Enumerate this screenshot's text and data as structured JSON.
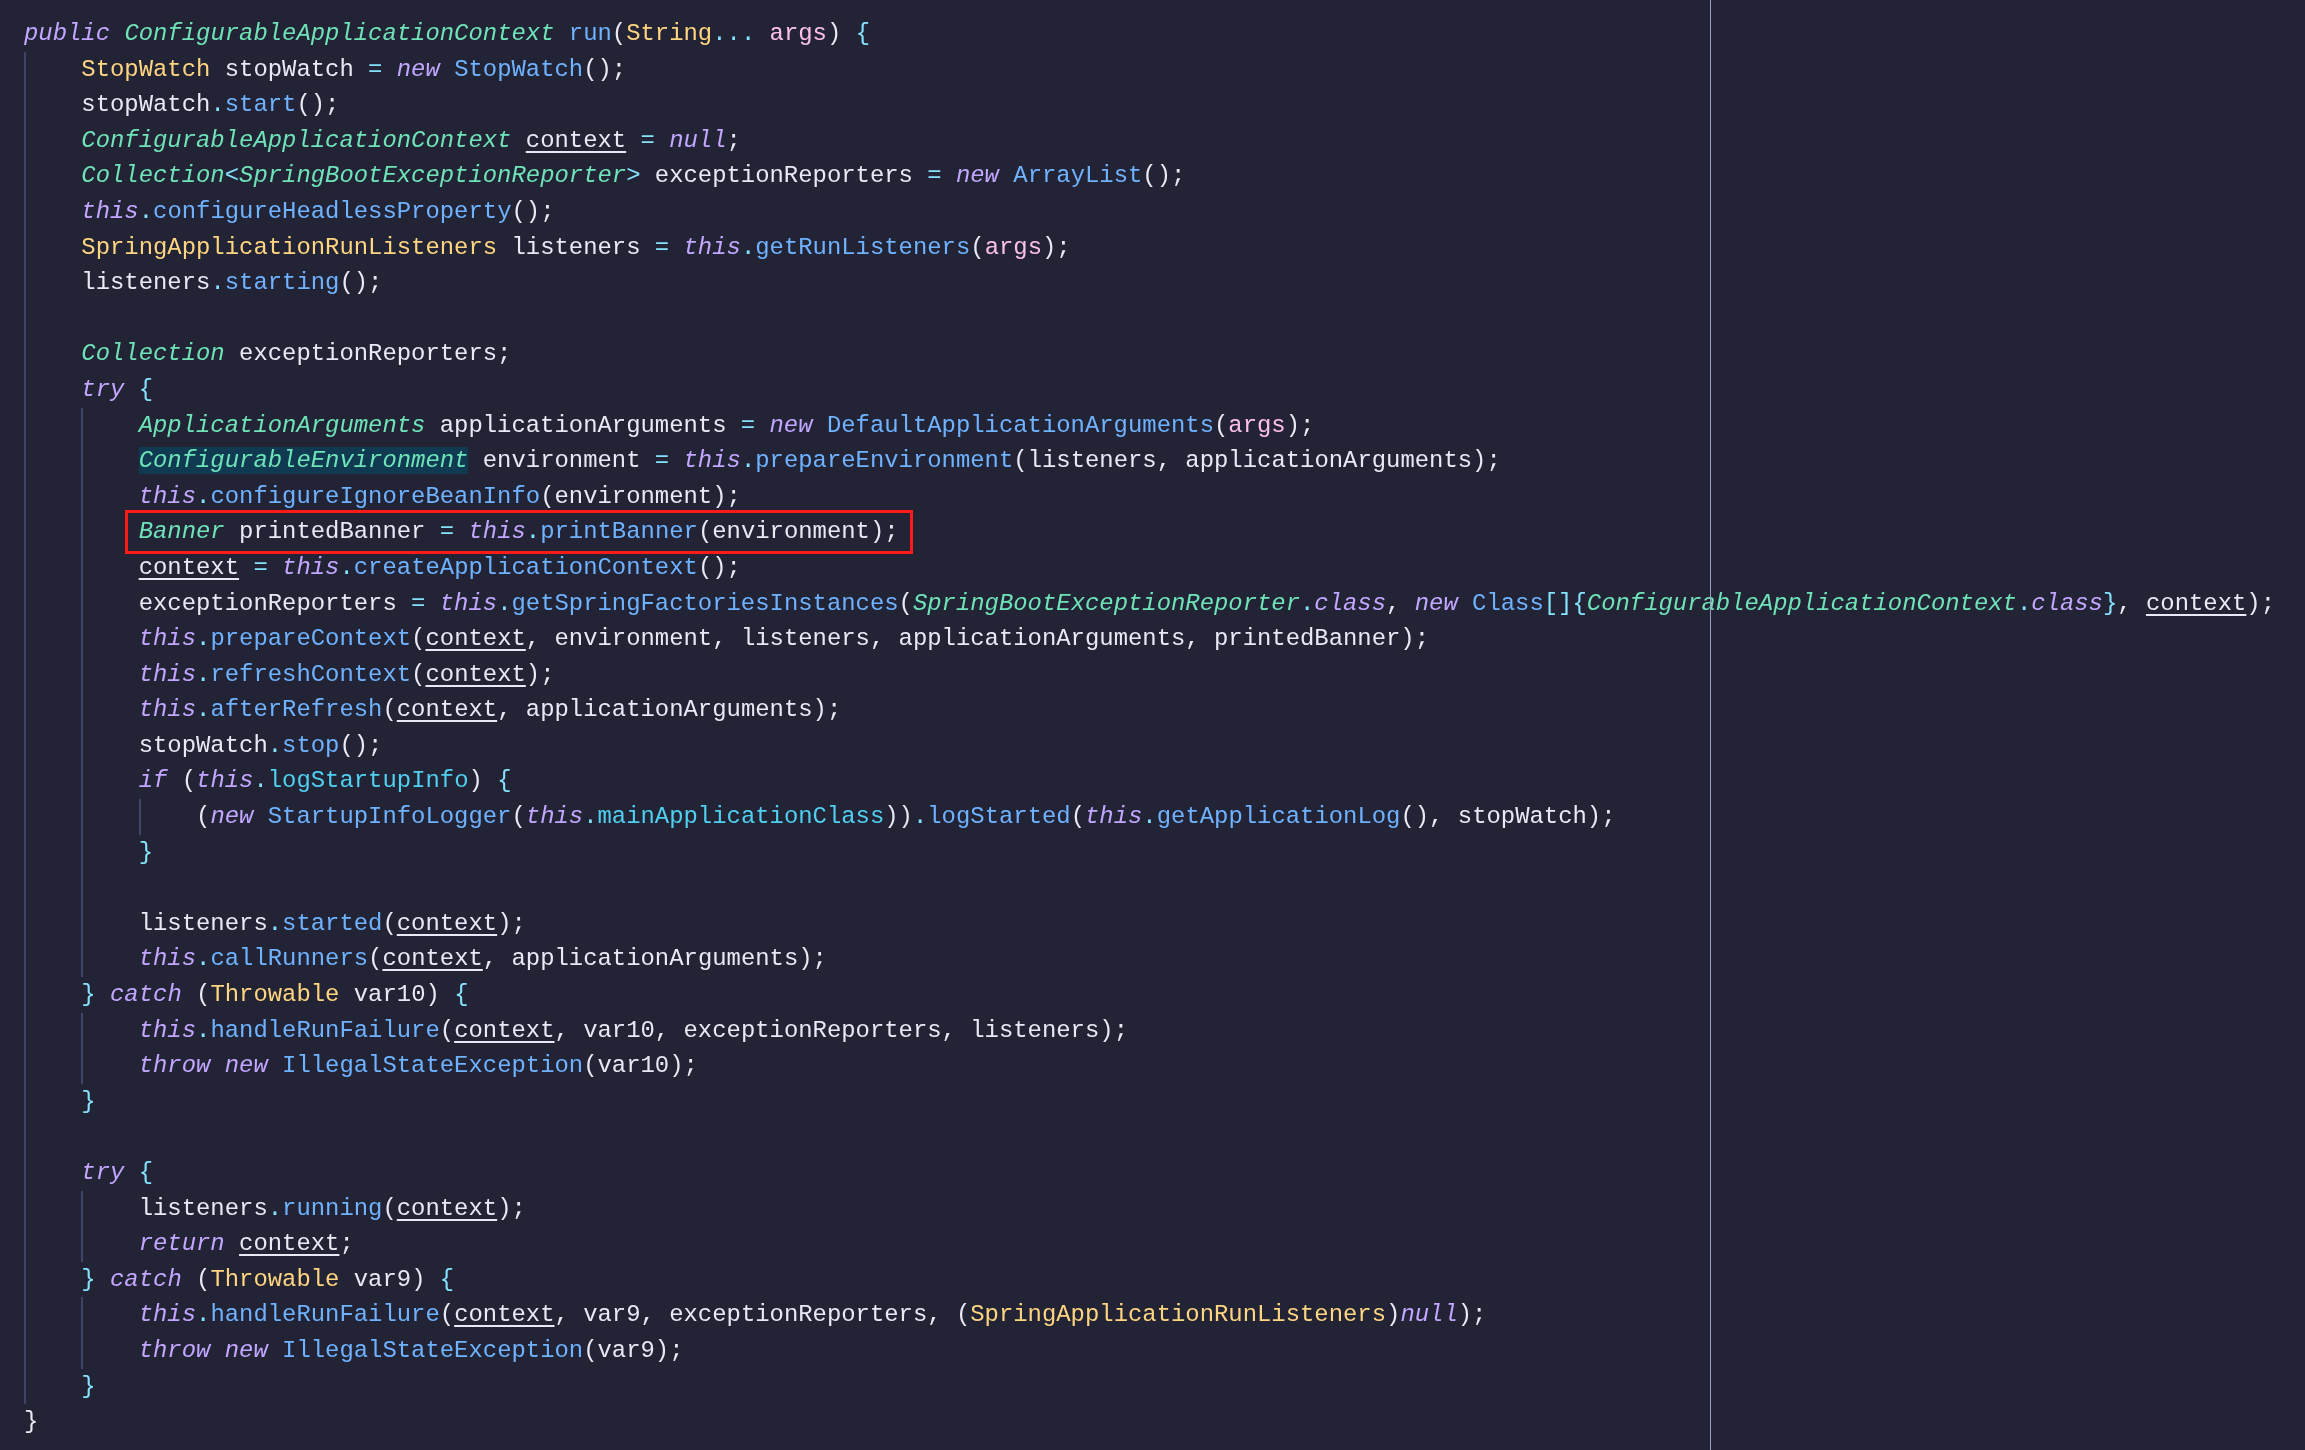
{
  "editor": {
    "lines": [
      {
        "kind": "code",
        "boxed": false,
        "tokens": [
          {
            "kind": "keyword",
            "text": "public"
          },
          {
            "kind": "type",
            "text": "ConfigurableApplicationContext",
            "gap": true
          },
          {
            "kind": "call",
            "text": "run",
            "gap": true
          },
          {
            "kind": "plain",
            "text": "("
          },
          {
            "kind": "classname",
            "text": "String"
          },
          {
            "kind": "operator",
            "text": "..."
          },
          {
            "kind": "param",
            "text": "args",
            "gap": true
          },
          {
            "kind": "plain",
            "text": ")"
          },
          {
            "kind": "operator",
            "text": "{",
            "gap": true
          }
        ],
        "children": [
          {
            "kind": "code",
            "boxed": false,
            "tokens": [
              {
                "kind": "classname",
                "text": "StopWatch"
              },
              {
                "kind": "plain",
                "text": "stopWatch",
                "gap": true
              },
              {
                "kind": "operator",
                "text": "=",
                "gap": true
              },
              {
                "kind": "keyword",
                "text": "new",
                "gap": true
              },
              {
                "kind": "call",
                "text": "StopWatch",
                "gap": true
              },
              {
                "kind": "plain",
                "text": "();"
              }
            ]
          },
          {
            "kind": "code",
            "boxed": false,
            "tokens": [
              {
                "kind": "plain",
                "text": "stopWatch"
              },
              {
                "kind": "operator",
                "text": "."
              },
              {
                "kind": "call",
                "text": "start"
              },
              {
                "kind": "plain",
                "text": "();"
              }
            ]
          },
          {
            "kind": "code",
            "boxed": false,
            "tokens": [
              {
                "kind": "type",
                "text": "ConfigurableApplicationContext"
              },
              {
                "kind": "variable",
                "text": "context",
                "gap": true
              },
              {
                "kind": "operator",
                "text": "=",
                "gap": true
              },
              {
                "kind": "keyword",
                "text": "null",
                "gap": true
              },
              {
                "kind": "plain",
                "text": ";"
              }
            ]
          },
          {
            "kind": "code",
            "boxed": false,
            "tokens": [
              {
                "kind": "type",
                "text": "Collection"
              },
              {
                "kind": "operator",
                "text": "<"
              },
              {
                "kind": "type",
                "text": "SpringBootExceptionReporter"
              },
              {
                "kind": "operator",
                "text": ">"
              },
              {
                "kind": "plain",
                "text": "exceptionReporters",
                "gap": true
              },
              {
                "kind": "operator",
                "text": "=",
                "gap": true
              },
              {
                "kind": "keyword",
                "text": "new",
                "gap": true
              },
              {
                "kind": "call",
                "text": "ArrayList",
                "gap": true
              },
              {
                "kind": "plain",
                "text": "();"
              }
            ]
          },
          {
            "kind": "code",
            "boxed": false,
            "tokens": [
              {
                "kind": "keyword",
                "text": "this"
              },
              {
                "kind": "operator",
                "text": "."
              },
              {
                "kind": "call",
                "text": "configureHeadlessProperty"
              },
              {
                "kind": "plain",
                "text": "();"
              }
            ]
          },
          {
            "kind": "code",
            "boxed": false,
            "tokens": [
              {
                "kind": "classname",
                "text": "SpringApplicationRunListeners"
              },
              {
                "kind": "plain",
                "text": "listeners",
                "gap": true
              },
              {
                "kind": "operator",
                "text": "=",
                "gap": true
              },
              {
                "kind": "keyword",
                "text": "this",
                "gap": true
              },
              {
                "kind": "operator",
                "text": "."
              },
              {
                "kind": "call",
                "text": "getRunListeners"
              },
              {
                "kind": "plain",
                "text": "("
              },
              {
                "kind": "param",
                "text": "args"
              },
              {
                "kind": "plain",
                "text": ");"
              }
            ]
          },
          {
            "kind": "code",
            "boxed": false,
            "tokens": [
              {
                "kind": "plain",
                "text": "listeners"
              },
              {
                "kind": "operator",
                "text": "."
              },
              {
                "kind": "call",
                "text": "starting"
              },
              {
                "kind": "plain",
                "text": "();"
              }
            ]
          },
          {
            "kind": "blank"
          },
          {
            "kind": "code",
            "boxed": false,
            "tokens": [
              {
                "kind": "type",
                "text": "Collection"
              },
              {
                "kind": "plain",
                "text": "exceptionReporters;",
                "gap": true
              }
            ]
          },
          {
            "kind": "code",
            "boxed": false,
            "tokens": [
              {
                "kind": "keyword",
                "text": "try"
              },
              {
                "kind": "operator",
                "text": "{",
                "gap": true
              }
            ],
            "children": [
              {
                "kind": "code",
                "boxed": false,
                "tokens": [
                  {
                    "kind": "type",
                    "text": "ApplicationArguments"
                  },
                  {
                    "kind": "plain",
                    "text": "applicationArguments",
                    "gap": true
                  },
                  {
                    "kind": "operator",
                    "text": "=",
                    "gap": true
                  },
                  {
                    "kind": "keyword",
                    "text": "new",
                    "gap": true
                  },
                  {
                    "kind": "call",
                    "text": "DefaultApplicationArguments",
                    "gap": true
                  },
                  {
                    "kind": "plain",
                    "text": "("
                  },
                  {
                    "kind": "param",
                    "text": "args"
                  },
                  {
                    "kind": "plain",
                    "text": ");"
                  }
                ]
              },
              {
                "kind": "code",
                "boxed": false,
                "tokens": [
                  {
                    "kind": "match",
                    "text": "ConfigurableEnvironment"
                  },
                  {
                    "kind": "plain",
                    "text": "environment",
                    "gap": true
                  },
                  {
                    "kind": "operator",
                    "text": "=",
                    "gap": true
                  },
                  {
                    "kind": "keyword",
                    "text": "this",
                    "gap": true
                  },
                  {
                    "kind": "operator",
                    "text": "."
                  },
                  {
                    "kind": "call",
                    "text": "prepareEnvironment"
                  },
                  {
                    "kind": "plain",
                    "text": "(listeners,"
                  },
                  {
                    "kind": "plain",
                    "text": "applicationArguments);",
                    "gap": true
                  }
                ]
              },
              {
                "kind": "code",
                "boxed": false,
                "tokens": [
                  {
                    "kind": "keyword",
                    "text": "this"
                  },
                  {
                    "kind": "operator",
                    "text": "."
                  },
                  {
                    "kind": "call",
                    "text": "configureIgnoreBeanInfo"
                  },
                  {
                    "kind": "plain",
                    "text": "(environment);"
                  }
                ]
              },
              {
                "kind": "code",
                "boxed": true,
                "tokens": [
                  {
                    "kind": "type",
                    "text": "Banner"
                  },
                  {
                    "kind": "plain",
                    "text": "printedBanner",
                    "gap": true
                  },
                  {
                    "kind": "operator",
                    "text": "=",
                    "gap": true
                  },
                  {
                    "kind": "keyword",
                    "text": "this",
                    "gap": true
                  },
                  {
                    "kind": "operator",
                    "text": "."
                  },
                  {
                    "kind": "call",
                    "text": "printBanner"
                  },
                  {
                    "kind": "plain",
                    "text": "(environment);"
                  }
                ]
              },
              {
                "kind": "code",
                "boxed": false,
                "tokens": [
                  {
                    "kind": "variable",
                    "text": "context"
                  },
                  {
                    "kind": "operator",
                    "text": "=",
                    "gap": true
                  },
                  {
                    "kind": "keyword",
                    "text": "this",
                    "gap": true
                  },
                  {
                    "kind": "operator",
                    "text": "."
                  },
                  {
                    "kind": "call",
                    "text": "createApplicationContext"
                  },
                  {
                    "kind": "plain",
                    "text": "();"
                  }
                ]
              },
              {
                "kind": "code",
                "boxed": false,
                "tokens": [
                  {
                    "kind": "plain",
                    "text": "exceptionReporters"
                  },
                  {
                    "kind": "operator",
                    "text": "=",
                    "gap": true
                  },
                  {
                    "kind": "keyword",
                    "text": "this",
                    "gap": true
                  },
                  {
                    "kind": "operator",
                    "text": "."
                  },
                  {
                    "kind": "call",
                    "text": "getSpringFactoriesInstances"
                  },
                  {
                    "kind": "plain",
                    "text": "("
                  },
                  {
                    "kind": "type",
                    "text": "SpringBootExceptionReporter"
                  },
                  {
                    "kind": "operator",
                    "text": "."
                  },
                  {
                    "kind": "keyword",
                    "text": "class"
                  },
                  {
                    "kind": "plain",
                    "text": ","
                  },
                  {
                    "kind": "keyword",
                    "text": "new",
                    "gap": true
                  },
                  {
                    "kind": "call",
                    "text": "Class",
                    "gap": true
                  },
                  {
                    "kind": "operator",
                    "text": "[]{"
                  },
                  {
                    "kind": "type",
                    "text": "ConfigurableApplicationContext"
                  },
                  {
                    "kind": "operator",
                    "text": "."
                  },
                  {
                    "kind": "keyword",
                    "text": "class"
                  },
                  {
                    "kind": "operator",
                    "text": "}"
                  },
                  {
                    "kind": "plain",
                    "text": ","
                  },
                  {
                    "kind": "variable",
                    "text": "context",
                    "gap": true
                  },
                  {
                    "kind": "plain",
                    "text": ");"
                  }
                ]
              },
              {
                "kind": "code",
                "boxed": false,
                "tokens": [
                  {
                    "kind": "keyword",
                    "text": "this"
                  },
                  {
                    "kind": "operator",
                    "text": "."
                  },
                  {
                    "kind": "call",
                    "text": "prepareContext"
                  },
                  {
                    "kind": "plain",
                    "text": "("
                  },
                  {
                    "kind": "variable",
                    "text": "context"
                  },
                  {
                    "kind": "plain",
                    "text": ","
                  },
                  {
                    "kind": "plain",
                    "text": "environment, listeners, applicationArguments, printedBanner);",
                    "gap": true
                  }
                ]
              },
              {
                "kind": "code",
                "boxed": false,
                "tokens": [
                  {
                    "kind": "keyword",
                    "text": "this"
                  },
                  {
                    "kind": "operator",
                    "text": "."
                  },
                  {
                    "kind": "call",
                    "text": "refreshContext"
                  },
                  {
                    "kind": "plain",
                    "text": "("
                  },
                  {
                    "kind": "variable",
                    "text": "context"
                  },
                  {
                    "kind": "plain",
                    "text": ");"
                  }
                ]
              },
              {
                "kind": "code",
                "boxed": false,
                "tokens": [
                  {
                    "kind": "keyword",
                    "text": "this"
                  },
                  {
                    "kind": "operator",
                    "text": "."
                  },
                  {
                    "kind": "call",
                    "text": "afterRefresh"
                  },
                  {
                    "kind": "plain",
                    "text": "("
                  },
                  {
                    "kind": "variable",
                    "text": "context"
                  },
                  {
                    "kind": "plain",
                    "text": ","
                  },
                  {
                    "kind": "plain",
                    "text": "applicationArguments);",
                    "gap": true
                  }
                ]
              },
              {
                "kind": "code",
                "boxed": false,
                "tokens": [
                  {
                    "kind": "plain",
                    "text": "stopWatch"
                  },
                  {
                    "kind": "operator",
                    "text": "."
                  },
                  {
                    "kind": "call",
                    "text": "stop"
                  },
                  {
                    "kind": "plain",
                    "text": "();"
                  }
                ]
              },
              {
                "kind": "code",
                "boxed": false,
                "tokens": [
                  {
                    "kind": "keyword",
                    "text": "if"
                  },
                  {
                    "kind": "plain",
                    "text": "(",
                    "gap": true
                  },
                  {
                    "kind": "keyword",
                    "text": "this"
                  },
                  {
                    "kind": "operator",
                    "text": "."
                  },
                  {
                    "kind": "field",
                    "text": "logStartupInfo"
                  },
                  {
                    "kind": "plain",
                    "text": ")"
                  },
                  {
                    "kind": "operator",
                    "text": "{",
                    "gap": true
                  }
                ],
                "children": [
                  {
                    "kind": "code",
                    "boxed": false,
                    "tokens": [
                      {
                        "kind": "plain",
                        "text": "("
                      },
                      {
                        "kind": "keyword",
                        "text": "new"
                      },
                      {
                        "kind": "call",
                        "text": "StartupInfoLogger",
                        "gap": true
                      },
                      {
                        "kind": "plain",
                        "text": "("
                      },
                      {
                        "kind": "keyword",
                        "text": "this"
                      },
                      {
                        "kind": "operator",
                        "text": "."
                      },
                      {
                        "kind": "field",
                        "text": "mainApplicationClass"
                      },
                      {
                        "kind": "plain",
                        "text": "))"
                      },
                      {
                        "kind": "operator",
                        "text": "."
                      },
                      {
                        "kind": "call",
                        "text": "logStarted"
                      },
                      {
                        "kind": "plain",
                        "text": "("
                      },
                      {
                        "kind": "keyword",
                        "text": "this"
                      },
                      {
                        "kind": "operator",
                        "text": "."
                      },
                      {
                        "kind": "call",
                        "text": "getApplicationLog"
                      },
                      {
                        "kind": "plain",
                        "text": "(),"
                      },
                      {
                        "kind": "plain",
                        "text": "stopWatch);",
                        "gap": true
                      }
                    ]
                  }
                ]
              },
              {
                "kind": "code",
                "boxed": false,
                "tokens": [
                  {
                    "kind": "operator",
                    "text": "}"
                  }
                ]
              },
              {
                "kind": "blank"
              },
              {
                "kind": "code",
                "boxed": false,
                "tokens": [
                  {
                    "kind": "plain",
                    "text": "listeners"
                  },
                  {
                    "kind": "operator",
                    "text": "."
                  },
                  {
                    "kind": "call",
                    "text": "started"
                  },
                  {
                    "kind": "plain",
                    "text": "("
                  },
                  {
                    "kind": "variable",
                    "text": "context"
                  },
                  {
                    "kind": "plain",
                    "text": ");"
                  }
                ]
              },
              {
                "kind": "code",
                "boxed": false,
                "tokens": [
                  {
                    "kind": "keyword",
                    "text": "this"
                  },
                  {
                    "kind": "operator",
                    "text": "."
                  },
                  {
                    "kind": "call",
                    "text": "callRunners"
                  },
                  {
                    "kind": "plain",
                    "text": "("
                  },
                  {
                    "kind": "variable",
                    "text": "context"
                  },
                  {
                    "kind": "plain",
                    "text": ","
                  },
                  {
                    "kind": "plain",
                    "text": "applicationArguments);",
                    "gap": true
                  }
                ]
              }
            ]
          },
          {
            "kind": "code",
            "boxed": false,
            "tokens": [
              {
                "kind": "operator",
                "text": "}"
              },
              {
                "kind": "keyword",
                "text": "catch",
                "gap": true
              },
              {
                "kind": "plain",
                "text": "(",
                "gap": true
              },
              {
                "kind": "classname",
                "text": "Throwable"
              },
              {
                "kind": "plain",
                "text": "var10)",
                "gap": true
              },
              {
                "kind": "operator",
                "text": "{",
                "gap": true
              }
            ],
            "children": [
              {
                "kind": "code",
                "boxed": false,
                "tokens": [
                  {
                    "kind": "keyword",
                    "text": "this"
                  },
                  {
                    "kind": "operator",
                    "text": "."
                  },
                  {
                    "kind": "call",
                    "text": "handleRunFailure"
                  },
                  {
                    "kind": "plain",
                    "text": "("
                  },
                  {
                    "kind": "variable",
                    "text": "context"
                  },
                  {
                    "kind": "plain",
                    "text": ","
                  },
                  {
                    "kind": "plain",
                    "text": "var10, exceptionReporters, listeners);",
                    "gap": true
                  }
                ]
              },
              {
                "kind": "code",
                "boxed": false,
                "tokens": [
                  {
                    "kind": "keyword",
                    "text": "throw"
                  },
                  {
                    "kind": "keyword",
                    "text": "new",
                    "gap": true
                  },
                  {
                    "kind": "call",
                    "text": "IllegalStateException",
                    "gap": true
                  },
                  {
                    "kind": "plain",
                    "text": "(var10);"
                  }
                ]
              }
            ]
          },
          {
            "kind": "code",
            "boxed": false,
            "tokens": [
              {
                "kind": "operator",
                "text": "}"
              }
            ]
          },
          {
            "kind": "blank"
          },
          {
            "kind": "code",
            "boxed": false,
            "tokens": [
              {
                "kind": "keyword",
                "text": "try"
              },
              {
                "kind": "operator",
                "text": "{",
                "gap": true
              }
            ],
            "children": [
              {
                "kind": "code",
                "boxed": false,
                "tokens": [
                  {
                    "kind": "plain",
                    "text": "listeners"
                  },
                  {
                    "kind": "operator",
                    "text": "."
                  },
                  {
                    "kind": "call",
                    "text": "running"
                  },
                  {
                    "kind": "plain",
                    "text": "("
                  },
                  {
                    "kind": "variable",
                    "text": "context"
                  },
                  {
                    "kind": "plain",
                    "text": ");"
                  }
                ]
              },
              {
                "kind": "code",
                "boxed": false,
                "tokens": [
                  {
                    "kind": "keyword",
                    "text": "return"
                  },
                  {
                    "kind": "variable",
                    "text": "context",
                    "gap": true
                  },
                  {
                    "kind": "plain",
                    "text": ";"
                  }
                ]
              }
            ]
          },
          {
            "kind": "code",
            "boxed": false,
            "tokens": [
              {
                "kind": "operator",
                "text": "}"
              },
              {
                "kind": "keyword",
                "text": "catch",
                "gap": true
              },
              {
                "kind": "plain",
                "text": "(",
                "gap": true
              },
              {
                "kind": "classname",
                "text": "Throwable"
              },
              {
                "kind": "plain",
                "text": "var9)",
                "gap": true
              },
              {
                "kind": "operator",
                "text": "{",
                "gap": true
              }
            ],
            "children": [
              {
                "kind": "code",
                "boxed": false,
                "tokens": [
                  {
                    "kind": "keyword",
                    "text": "this"
                  },
                  {
                    "kind": "operator",
                    "text": "."
                  },
                  {
                    "kind": "call",
                    "text": "handleRunFailure"
                  },
                  {
                    "kind": "plain",
                    "text": "("
                  },
                  {
                    "kind": "variable",
                    "text": "context"
                  },
                  {
                    "kind": "plain",
                    "text": ","
                  },
                  {
                    "kind": "plain",
                    "text": "var9, exceptionReporters, (",
                    "gap": true
                  },
                  {
                    "kind": "classname",
                    "text": "SpringApplicationRunListeners"
                  },
                  {
                    "kind": "plain",
                    "text": ")"
                  },
                  {
                    "kind": "keyword",
                    "text": "null"
                  },
                  {
                    "kind": "plain",
                    "text": ");"
                  }
                ]
              },
              {
                "kind": "code",
                "boxed": false,
                "tokens": [
                  {
                    "kind": "keyword",
                    "text": "throw"
                  },
                  {
                    "kind": "keyword",
                    "text": "new",
                    "gap": true
                  },
                  {
                    "kind": "call",
                    "text": "IllegalStateException",
                    "gap": true
                  },
                  {
                    "kind": "plain",
                    "text": "(var9);"
                  }
                ]
              }
            ]
          },
          {
            "kind": "code",
            "boxed": false,
            "tokens": [
              {
                "kind": "operator",
                "text": "}"
              }
            ]
          }
        ]
      },
      {
        "kind": "code",
        "boxed": false,
        "tokens": [
          {
            "kind": "plain",
            "text": "}"
          }
        ]
      }
    ]
  }
}
